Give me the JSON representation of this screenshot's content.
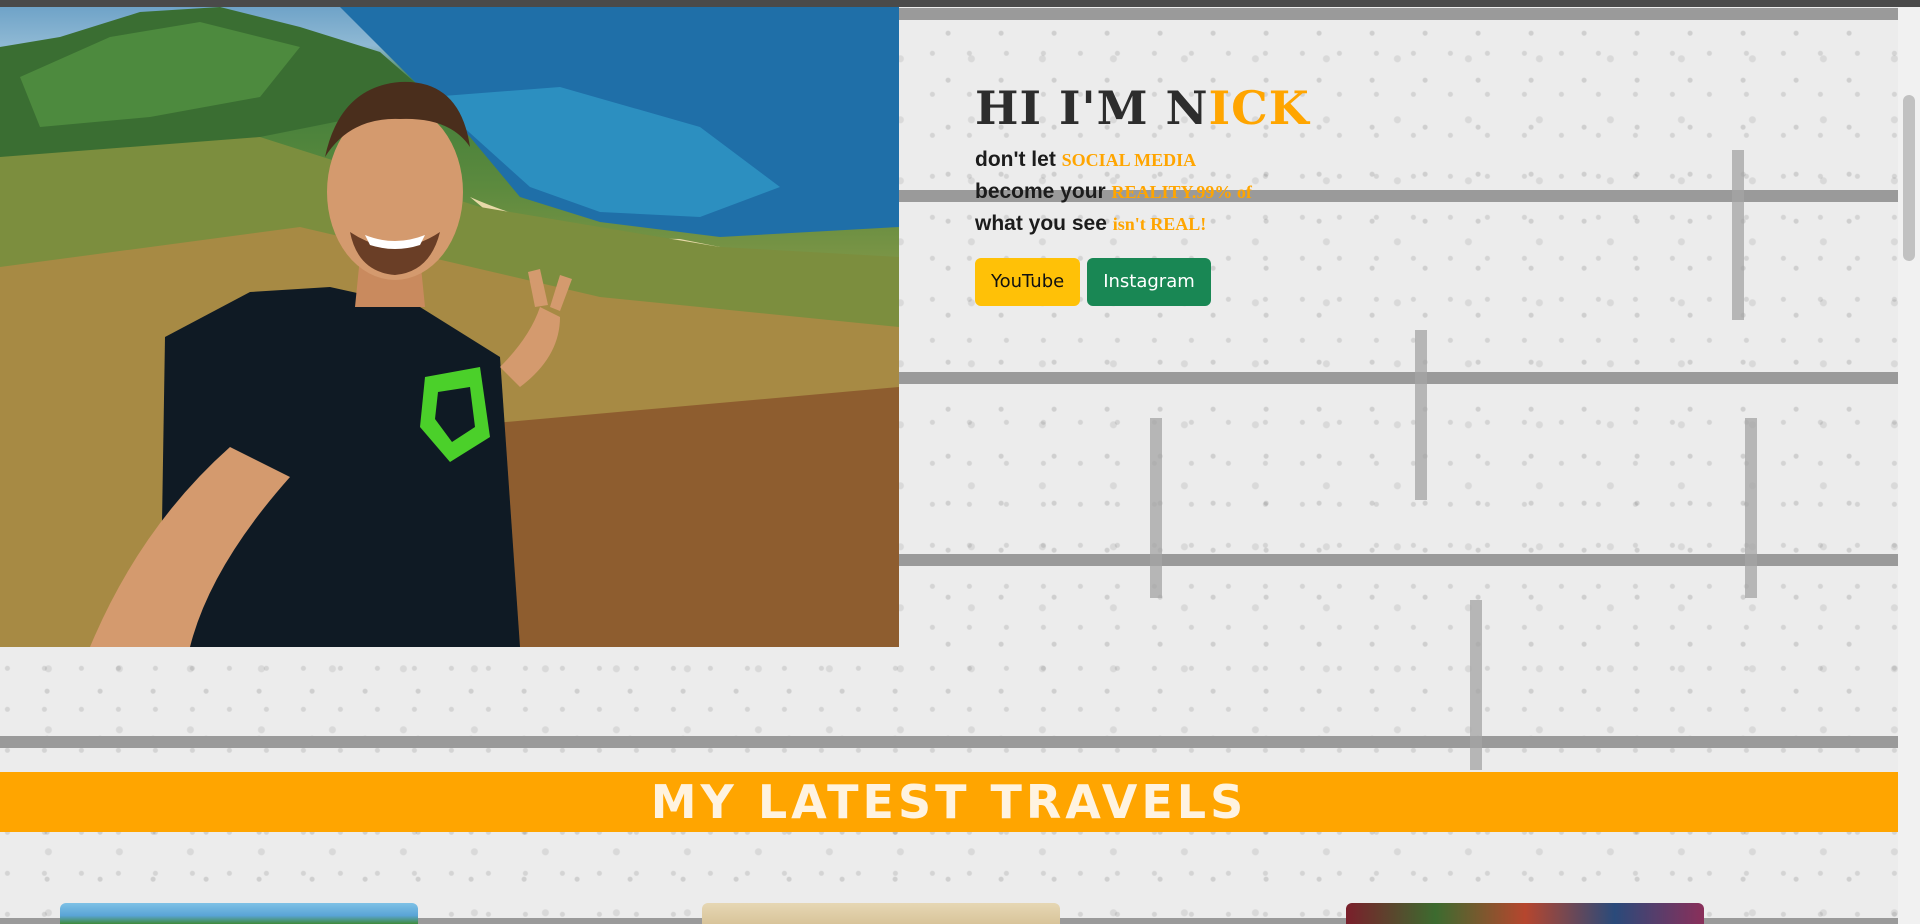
{
  "hero": {
    "title_prefix": "HI I'M N",
    "title_accent": "ICK",
    "tagline_1": "don't let ",
    "tagline_1_hl": "SOCIAL MEDIA",
    "tagline_2": "become your ",
    "tagline_2_hl": "REALITY.99% of",
    "tagline_3": "what you see ",
    "tagline_3_hl": "isn't REAL!",
    "youtube_label": "YouTube",
    "instagram_label": "Instagram"
  },
  "travels": {
    "heading": "MY LATEST TRAVELS"
  },
  "colors": {
    "accent": "#ffa500",
    "youtube_button": "#ffc107",
    "instagram_button": "#198754"
  }
}
